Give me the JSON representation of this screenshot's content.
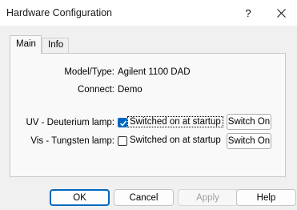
{
  "window": {
    "title": "Hardware Configuration",
    "help_glyph": "?",
    "close_icon": "close-icon"
  },
  "tabs": [
    {
      "label": "Main",
      "active": true
    },
    {
      "label": "Info",
      "active": false
    }
  ],
  "main": {
    "model_type_label": "Model/Type:",
    "model_type_value": "Agilent 1100 DAD",
    "connect_label": "Connect:",
    "connect_value": "Demo",
    "lamps": [
      {
        "label": "UV - Deuterium lamp:",
        "checkbox_label": "Switched on at startup",
        "checked": true,
        "button_label": "Switch On"
      },
      {
        "label": "Vis - Tungsten lamp:",
        "checkbox_label": "Switched on at startup",
        "checked": false,
        "button_label": "Switch On"
      }
    ]
  },
  "buttons": {
    "ok": "OK",
    "cancel": "Cancel",
    "apply": "Apply",
    "help": "Help"
  },
  "colors": {
    "accent": "#0067c0",
    "dialog_bg": "#f0f0f0",
    "panel_bg": "#f9f9f9"
  }
}
